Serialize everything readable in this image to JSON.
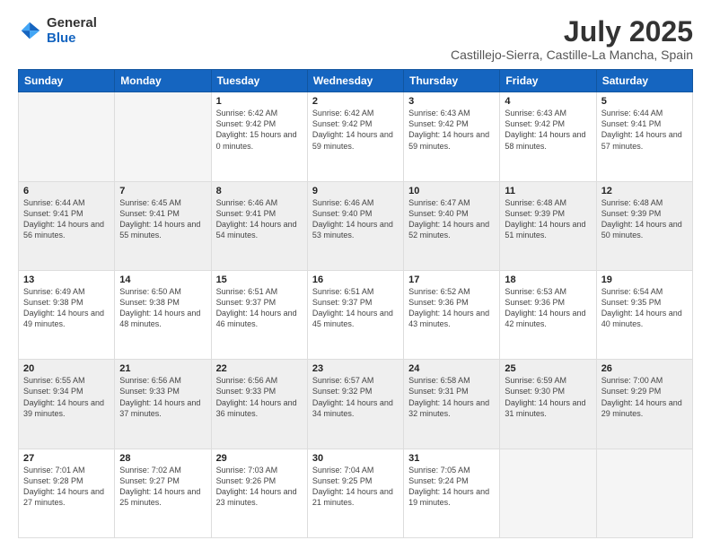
{
  "logo": {
    "general": "General",
    "blue": "Blue"
  },
  "title": "July 2025",
  "subtitle": "Castillejo-Sierra, Castille-La Mancha, Spain",
  "weekdays": [
    "Sunday",
    "Monday",
    "Tuesday",
    "Wednesday",
    "Thursday",
    "Friday",
    "Saturday"
  ],
  "weeks": [
    [
      {
        "day": "",
        "info": ""
      },
      {
        "day": "",
        "info": ""
      },
      {
        "day": "1",
        "info": "Sunrise: 6:42 AM\nSunset: 9:42 PM\nDaylight: 15 hours and 0 minutes."
      },
      {
        "day": "2",
        "info": "Sunrise: 6:42 AM\nSunset: 9:42 PM\nDaylight: 14 hours and 59 minutes."
      },
      {
        "day": "3",
        "info": "Sunrise: 6:43 AM\nSunset: 9:42 PM\nDaylight: 14 hours and 59 minutes."
      },
      {
        "day": "4",
        "info": "Sunrise: 6:43 AM\nSunset: 9:42 PM\nDaylight: 14 hours and 58 minutes."
      },
      {
        "day": "5",
        "info": "Sunrise: 6:44 AM\nSunset: 9:41 PM\nDaylight: 14 hours and 57 minutes."
      }
    ],
    [
      {
        "day": "6",
        "info": "Sunrise: 6:44 AM\nSunset: 9:41 PM\nDaylight: 14 hours and 56 minutes."
      },
      {
        "day": "7",
        "info": "Sunrise: 6:45 AM\nSunset: 9:41 PM\nDaylight: 14 hours and 55 minutes."
      },
      {
        "day": "8",
        "info": "Sunrise: 6:46 AM\nSunset: 9:41 PM\nDaylight: 14 hours and 54 minutes."
      },
      {
        "day": "9",
        "info": "Sunrise: 6:46 AM\nSunset: 9:40 PM\nDaylight: 14 hours and 53 minutes."
      },
      {
        "day": "10",
        "info": "Sunrise: 6:47 AM\nSunset: 9:40 PM\nDaylight: 14 hours and 52 minutes."
      },
      {
        "day": "11",
        "info": "Sunrise: 6:48 AM\nSunset: 9:39 PM\nDaylight: 14 hours and 51 minutes."
      },
      {
        "day": "12",
        "info": "Sunrise: 6:48 AM\nSunset: 9:39 PM\nDaylight: 14 hours and 50 minutes."
      }
    ],
    [
      {
        "day": "13",
        "info": "Sunrise: 6:49 AM\nSunset: 9:38 PM\nDaylight: 14 hours and 49 minutes."
      },
      {
        "day": "14",
        "info": "Sunrise: 6:50 AM\nSunset: 9:38 PM\nDaylight: 14 hours and 48 minutes."
      },
      {
        "day": "15",
        "info": "Sunrise: 6:51 AM\nSunset: 9:37 PM\nDaylight: 14 hours and 46 minutes."
      },
      {
        "day": "16",
        "info": "Sunrise: 6:51 AM\nSunset: 9:37 PM\nDaylight: 14 hours and 45 minutes."
      },
      {
        "day": "17",
        "info": "Sunrise: 6:52 AM\nSunset: 9:36 PM\nDaylight: 14 hours and 43 minutes."
      },
      {
        "day": "18",
        "info": "Sunrise: 6:53 AM\nSunset: 9:36 PM\nDaylight: 14 hours and 42 minutes."
      },
      {
        "day": "19",
        "info": "Sunrise: 6:54 AM\nSunset: 9:35 PM\nDaylight: 14 hours and 40 minutes."
      }
    ],
    [
      {
        "day": "20",
        "info": "Sunrise: 6:55 AM\nSunset: 9:34 PM\nDaylight: 14 hours and 39 minutes."
      },
      {
        "day": "21",
        "info": "Sunrise: 6:56 AM\nSunset: 9:33 PM\nDaylight: 14 hours and 37 minutes."
      },
      {
        "day": "22",
        "info": "Sunrise: 6:56 AM\nSunset: 9:33 PM\nDaylight: 14 hours and 36 minutes."
      },
      {
        "day": "23",
        "info": "Sunrise: 6:57 AM\nSunset: 9:32 PM\nDaylight: 14 hours and 34 minutes."
      },
      {
        "day": "24",
        "info": "Sunrise: 6:58 AM\nSunset: 9:31 PM\nDaylight: 14 hours and 32 minutes."
      },
      {
        "day": "25",
        "info": "Sunrise: 6:59 AM\nSunset: 9:30 PM\nDaylight: 14 hours and 31 minutes."
      },
      {
        "day": "26",
        "info": "Sunrise: 7:00 AM\nSunset: 9:29 PM\nDaylight: 14 hours and 29 minutes."
      }
    ],
    [
      {
        "day": "27",
        "info": "Sunrise: 7:01 AM\nSunset: 9:28 PM\nDaylight: 14 hours and 27 minutes."
      },
      {
        "day": "28",
        "info": "Sunrise: 7:02 AM\nSunset: 9:27 PM\nDaylight: 14 hours and 25 minutes."
      },
      {
        "day": "29",
        "info": "Sunrise: 7:03 AM\nSunset: 9:26 PM\nDaylight: 14 hours and 23 minutes."
      },
      {
        "day": "30",
        "info": "Sunrise: 7:04 AM\nSunset: 9:25 PM\nDaylight: 14 hours and 21 minutes."
      },
      {
        "day": "31",
        "info": "Sunrise: 7:05 AM\nSunset: 9:24 PM\nDaylight: 14 hours and 19 minutes."
      },
      {
        "day": "",
        "info": ""
      },
      {
        "day": "",
        "info": ""
      }
    ]
  ]
}
